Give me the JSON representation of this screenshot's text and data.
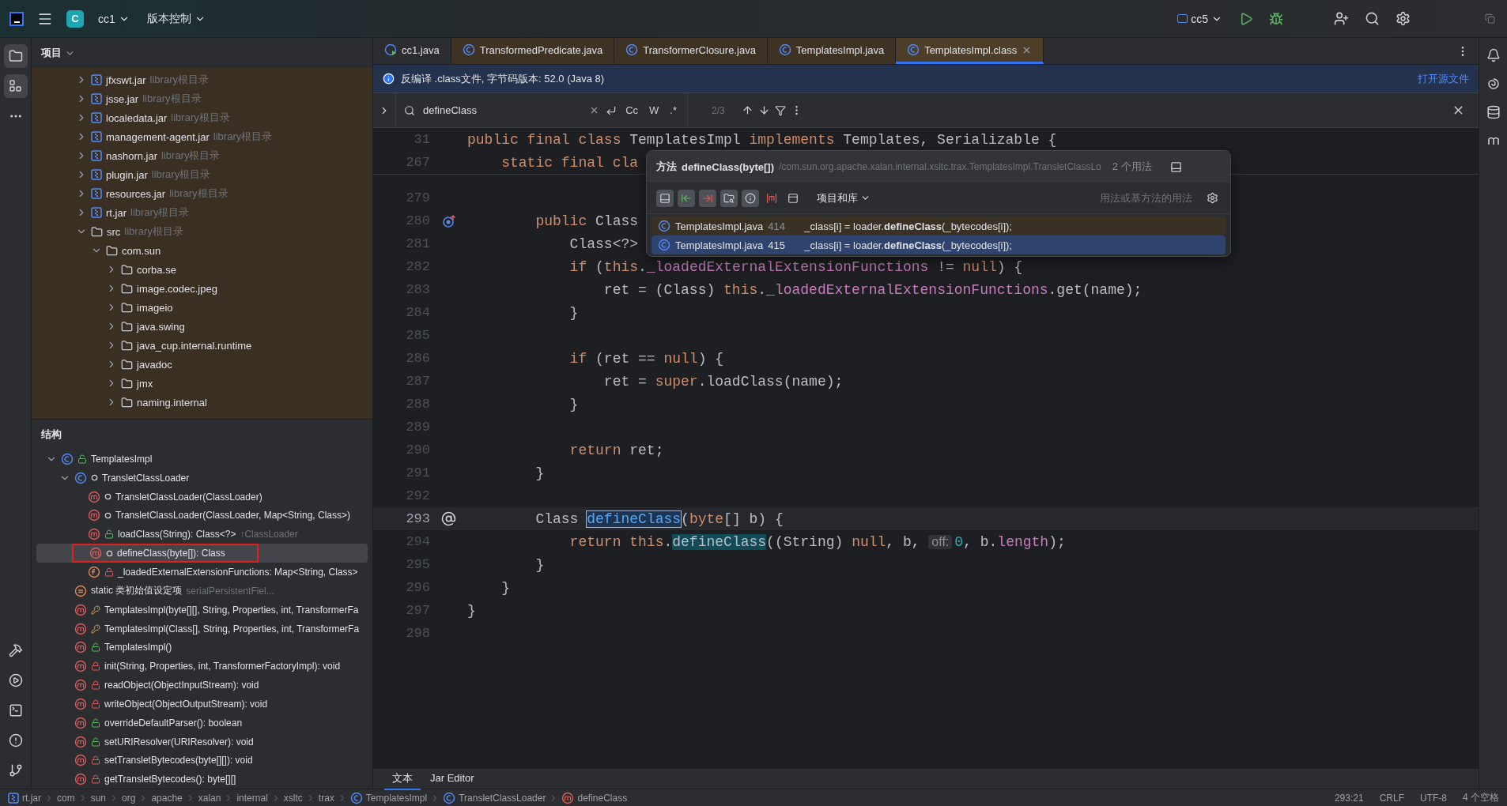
{
  "titlebar": {
    "project_badge": "C",
    "project": "cc1",
    "vcs": "版本控制",
    "run_config": "cc5"
  },
  "activity_top": [
    {
      "kind": "project",
      "selected": true
    },
    {
      "kind": "structure",
      "selected": true
    },
    {
      "kind": "more",
      "selected": false
    }
  ],
  "activity_bottom": [
    {
      "kind": "build"
    },
    {
      "kind": "run"
    },
    {
      "kind": "terminal"
    },
    {
      "kind": "problems"
    },
    {
      "kind": "git"
    }
  ],
  "project_panel": {
    "title": "项目",
    "items": [
      {
        "kind": "jar",
        "label": "jfxswt.jar",
        "hint": "library根目录",
        "expanded": false
      },
      {
        "kind": "jar",
        "label": "jsse.jar",
        "hint": "library根目录",
        "expanded": false
      },
      {
        "kind": "jar",
        "label": "localedata.jar",
        "hint": "library根目录",
        "expanded": false
      },
      {
        "kind": "jar",
        "label": "management-agent.jar",
        "hint": "library根目录",
        "expanded": false
      },
      {
        "kind": "jar",
        "label": "nashorn.jar",
        "hint": "library根目录",
        "expanded": false
      },
      {
        "kind": "jar",
        "label": "plugin.jar",
        "hint": "library根目录",
        "expanded": false
      },
      {
        "kind": "jar",
        "label": "resources.jar",
        "hint": "library根目录",
        "expanded": false
      },
      {
        "kind": "jar",
        "label": "rt.jar",
        "hint": "library根目录",
        "expanded": false
      },
      {
        "kind": "folder",
        "label": "src",
        "hint": "library根目录",
        "expanded": true,
        "children": [
          {
            "kind": "folder",
            "label": "com.sun",
            "expanded": true,
            "children": [
              {
                "kind": "folder",
                "label": "corba.se",
                "expanded": false
              },
              {
                "kind": "folder",
                "label": "image.codec.jpeg",
                "expanded": false
              },
              {
                "kind": "folder",
                "label": "imageio",
                "expanded": false
              },
              {
                "kind": "folder",
                "label": "java.swing",
                "expanded": false
              },
              {
                "kind": "folder",
                "label": "java_cup.internal.runtime",
                "expanded": false
              },
              {
                "kind": "folder",
                "label": "javadoc",
                "expanded": false
              },
              {
                "kind": "folder",
                "label": "jmx",
                "expanded": false
              },
              {
                "kind": "folder",
                "label": "naming.internal",
                "expanded": false
              }
            ]
          }
        ]
      }
    ]
  },
  "structure_panel": {
    "title": "结构",
    "items": [
      {
        "kind": "class",
        "modifier": {
          "kind": "public"
        },
        "label": "TemplatesImpl",
        "expanded": true,
        "selected": false,
        "children": [
          {
            "kind": "inner-class",
            "modifier": {
              "kind": "package"
            },
            "label": "TransletClassLoader",
            "expanded": true,
            "selected": false,
            "children": [
              {
                "kind": "method",
                "modifier": {
                  "kind": "package"
                },
                "label": "TransletClassLoader(ClassLoader)",
                "selected": false
              },
              {
                "kind": "method",
                "modifier": {
                  "kind": "package"
                },
                "label": "TransletClassLoader(ClassLoader, Map<String, Class>)",
                "selected": false
              },
              {
                "kind": "method",
                "modifier": {
                  "kind": "public"
                },
                "label": "loadClass(String): Class<?>",
                "hint": "↑ClassLoader",
                "selected": false
              },
              {
                "kind": "method",
                "modifier": {
                  "kind": "package"
                },
                "label": "defineClass(byte[]): Class",
                "selected": true,
                "boxed": true
              },
              {
                "kind": "field",
                "modifier": {
                  "kind": "private"
                },
                "label": "_loadedExternalExtensionFunctions: Map<String, Class>",
                "selected": false
              }
            ]
          },
          {
            "kind": "initializer",
            "label": "static 类初始值设定项",
            "hint": "serialPersistentFiel...",
            "selected": false
          },
          {
            "kind": "method",
            "modifier": {
              "kind": "protected"
            },
            "label": "TemplatesImpl(byte[][], String, Properties, int, TransformerFa",
            "selected": false
          },
          {
            "kind": "method",
            "modifier": {
              "kind": "protected"
            },
            "label": "TemplatesImpl(Class[], String, Properties, int, TransformerFa",
            "selected": false
          },
          {
            "kind": "method",
            "modifier": {
              "kind": "public"
            },
            "label": "TemplatesImpl()",
            "selected": false
          },
          {
            "kind": "method",
            "modifier": {
              "kind": "private"
            },
            "label": "init(String, Properties, int, TransformerFactoryImpl): void",
            "selected": false
          },
          {
            "kind": "method",
            "modifier": {
              "kind": "private"
            },
            "label": "readObject(ObjectInputStream): void",
            "selected": false
          },
          {
            "kind": "method",
            "modifier": {
              "kind": "private"
            },
            "label": "writeObject(ObjectOutputStream): void",
            "selected": false
          },
          {
            "kind": "method",
            "modifier": {
              "kind": "public"
            },
            "label": "overrideDefaultParser(): boolean",
            "selected": false
          },
          {
            "kind": "method",
            "modifier": {
              "kind": "public"
            },
            "label": "setURIResolver(URIResolver): void",
            "selected": false
          },
          {
            "kind": "method",
            "modifier": {
              "kind": "private"
            },
            "label": "setTransletBytecodes(byte[][]): void",
            "selected": false
          },
          {
            "kind": "method",
            "modifier": {
              "kind": "private"
            },
            "label": "getTransletBytecodes(): byte[][]",
            "selected": false
          }
        ]
      }
    ]
  },
  "editor_tabs": [
    {
      "kind": "runnable",
      "label": "cc1.java",
      "library": false,
      "selected": false
    },
    {
      "kind": "class",
      "label": "TransformedPredicate.java",
      "library": true,
      "selected": false
    },
    {
      "kind": "plain-class",
      "label": "TransformerClosure.java",
      "library": true,
      "selected": false
    },
    {
      "kind": "class",
      "label": "TemplatesImpl.java",
      "library": true,
      "selected": false
    },
    {
      "kind": "class",
      "label": "TemplatesImpl.class",
      "library": true,
      "selected": true
    }
  ],
  "banner": {
    "text": "反编译 .class文件, 字节码版本: 52.0 (Java 8)",
    "link": "打开源文件"
  },
  "search": {
    "value": "defineClass",
    "options": [
      "Cc",
      "W",
      ".*"
    ],
    "count": "2/3"
  },
  "sticky_lines": [
    {
      "no": "31",
      "tokens": [
        {
          "kind": "kw",
          "t": "public final class"
        },
        {
          "kind": "txt",
          "t": " TemplatesImpl "
        },
        {
          "kind": "kw",
          "t": "implements"
        },
        {
          "kind": "txt",
          "t": " Templates, Serializable {"
        }
      ]
    },
    {
      "no": "267",
      "tokens": [
        {
          "kind": "kw",
          "t": "    static final cla"
        }
      ]
    }
  ],
  "lines": [
    {
      "no": "279",
      "current": false
    },
    {
      "no": "280",
      "current": false,
      "gutter": {
        "kind": "override"
      },
      "tokens": [
        {
          "kind": "kw",
          "t": "        public"
        },
        {
          "kind": "txt",
          "t": " Class"
        }
      ]
    },
    {
      "no": "281",
      "current": false,
      "tokens": [
        {
          "kind": "txt",
          "t": "            Class<?>"
        }
      ]
    },
    {
      "no": "282",
      "current": false,
      "tokens": [
        {
          "kind": "kw",
          "t": "            if"
        },
        {
          "kind": "txt",
          "t": " ("
        },
        {
          "kind": "kw",
          "t": "this"
        },
        {
          "kind": "txt",
          "t": "."
        },
        {
          "kind": "fld",
          "t": "_loadedExternalExtensionFunctions"
        },
        {
          "kind": "txt",
          "t": " != "
        },
        {
          "kind": "kw",
          "t": "null"
        },
        {
          "kind": "txt",
          "t": ") {"
        }
      ]
    },
    {
      "no": "283",
      "current": false,
      "tokens": [
        {
          "kind": "txt",
          "t": "                ret = (Class) "
        },
        {
          "kind": "kw",
          "t": "this"
        },
        {
          "kind": "txt",
          "t": "."
        },
        {
          "kind": "fld",
          "t": "_loadedExternalExtensionFunctions"
        },
        {
          "kind": "txt",
          "t": ".get(name);"
        }
      ]
    },
    {
      "no": "284",
      "current": false,
      "tokens": [
        {
          "kind": "txt",
          "t": "            }"
        }
      ]
    },
    {
      "no": "285",
      "current": false
    },
    {
      "no": "286",
      "current": false,
      "tokens": [
        {
          "kind": "kw",
          "t": "            if"
        },
        {
          "kind": "txt",
          "t": " (ret == "
        },
        {
          "kind": "kw",
          "t": "null"
        },
        {
          "kind": "txt",
          "t": ") {"
        }
      ]
    },
    {
      "no": "287",
      "current": false,
      "tokens": [
        {
          "kind": "txt",
          "t": "                ret = "
        },
        {
          "kind": "kw",
          "t": "super"
        },
        {
          "kind": "txt",
          "t": ".loadClass(name);"
        }
      ]
    },
    {
      "no": "288",
      "current": false,
      "tokens": [
        {
          "kind": "txt",
          "t": "            }"
        }
      ]
    },
    {
      "no": "289",
      "current": false
    },
    {
      "no": "290",
      "current": false,
      "tokens": [
        {
          "kind": "kw",
          "t": "            return"
        },
        {
          "kind": "txt",
          "t": " ret;"
        }
      ]
    },
    {
      "no": "291",
      "current": false,
      "tokens": [
        {
          "kind": "txt",
          "t": "        }"
        }
      ]
    },
    {
      "no": "292",
      "current": false
    },
    {
      "no": "293",
      "current": true,
      "gutter": {
        "kind": "at"
      },
      "tokens": [
        {
          "kind": "txt",
          "t": "        Class "
        },
        {
          "kind": "match-current",
          "t": "defineClass"
        },
        {
          "kind": "txt",
          "t": "("
        },
        {
          "kind": "kw",
          "t": "byte"
        },
        {
          "kind": "txt",
          "t": "[] b) {"
        }
      ]
    },
    {
      "no": "294",
      "current": false,
      "tokens": [
        {
          "kind": "kw",
          "t": "            return this"
        },
        {
          "kind": "txt",
          "t": "."
        },
        {
          "kind": "match",
          "t": "defineClass"
        },
        {
          "kind": "txt",
          "t": "((String) "
        },
        {
          "kind": "kw",
          "t": "null"
        },
        {
          "kind": "txt",
          "t": ", b, "
        },
        {
          "kind": "hint",
          "t": "off:"
        },
        {
          "kind": "num",
          "t": "0"
        },
        {
          "kind": "txt",
          "t": ", b."
        },
        {
          "kind": "fld",
          "t": "length"
        },
        {
          "kind": "txt",
          "t": ");"
        }
      ]
    },
    {
      "no": "295",
      "current": false,
      "tokens": [
        {
          "kind": "txt",
          "t": "        }"
        }
      ]
    },
    {
      "no": "296",
      "current": false,
      "tokens": [
        {
          "kind": "txt",
          "t": "    }"
        }
      ]
    },
    {
      "no": "297",
      "current": false,
      "tokens": [
        {
          "kind": "txt",
          "t": "}"
        }
      ]
    },
    {
      "no": "298",
      "current": false
    }
  ],
  "usages_popup": {
    "label": "方法",
    "method": "defineClass(byte[])",
    "path": "/com.sun.org.apache.xalan.internal.xsltc.trax.TemplatesImpl.TransletClassLo",
    "count": "2 个用法",
    "scope": "项目和库",
    "filter_label": "用法或基方法的用法",
    "filters": [
      {
        "kind": "merge",
        "on": true
      },
      {
        "kind": "read",
        "on": true
      },
      {
        "kind": "write",
        "on": true
      },
      {
        "kind": "folder",
        "on": true
      },
      {
        "kind": "info",
        "on": true
      },
      {
        "kind": "method",
        "on": false
      },
      {
        "kind": "preview",
        "on": false
      }
    ],
    "results": [
      {
        "file": "TemplatesImpl.java",
        "line": "414",
        "code": "_class[i] = loader.**defineClass**(_bytecodes[i]);",
        "library": true,
        "selected": false
      },
      {
        "file": "TemplatesImpl.java",
        "line": "415",
        "code": "_class[i] = loader.**defineClass**(_bytecodes[i]);",
        "library": true,
        "selected": true
      }
    ]
  },
  "bottom_tabs": [
    {
      "label": "文本",
      "selected": true
    },
    {
      "label": "Jar Editor",
      "selected": false
    }
  ],
  "right_strip": [
    {
      "kind": "notifications"
    },
    {
      "kind": "ai"
    },
    {
      "kind": "database"
    },
    {
      "kind": "maven"
    }
  ],
  "status_bar": {
    "breadcrumbs": [
      {
        "kind": "jar",
        "label": "rt.jar"
      },
      {
        "kind": "package",
        "label": "com"
      },
      {
        "kind": "package",
        "label": "sun"
      },
      {
        "kind": "package",
        "label": "org"
      },
      {
        "kind": "package",
        "label": "apache"
      },
      {
        "kind": "package",
        "label": "xalan"
      },
      {
        "kind": "package",
        "label": "internal"
      },
      {
        "kind": "package",
        "label": "xsltc"
      },
      {
        "kind": "package",
        "label": "trax"
      },
      {
        "kind": "class",
        "label": "TemplatesImpl"
      },
      {
        "kind": "class",
        "label": "TransletClassLoader"
      },
      {
        "kind": "method",
        "label": "defineClass"
      }
    ],
    "items": [
      "293:21",
      "CRLF",
      "UTF-8",
      "4 个空格"
    ]
  }
}
